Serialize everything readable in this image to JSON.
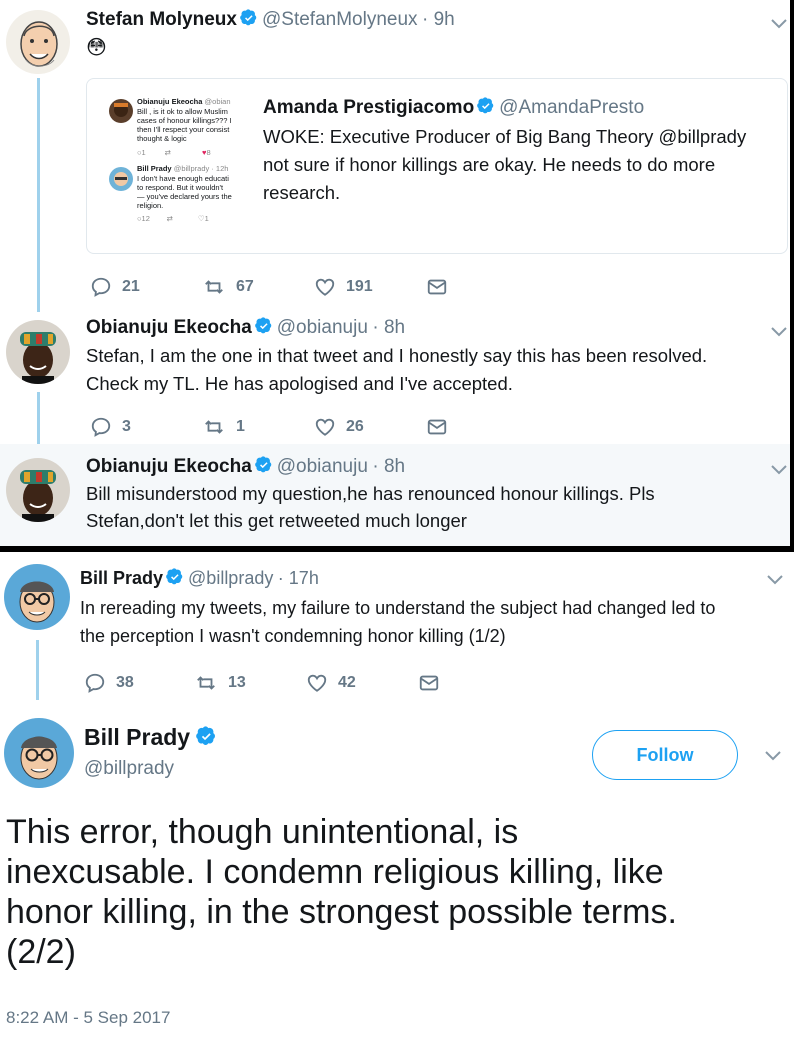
{
  "thread1": {
    "name": "Stefan Molyneux",
    "handle": "@StefanMolyneux",
    "time": "· 9h",
    "body": "😳",
    "quote": {
      "name": "Amanda Prestigiacomo",
      "handle": "@AmandaPresto",
      "text": "WOKE: Executive Producer of Big Bang Theory @billprady not sure if honor killings are okay. He needs to do more research.",
      "mini": {
        "t1_name": "Obianuju Ekeocha",
        "t1_handle": "@obian",
        "t1_line1": "Bill , is it ok to allow Muslim",
        "t1_line2": "cases of honour killings??? I",
        "t1_line3": "then I'll respect your consist",
        "t1_line4": "thought & logic",
        "t1_reply": "1",
        "t1_like": "8",
        "t2_name": "Bill Prady",
        "t2_handle": "@billprady · 12h",
        "t2_line1": "I don't have enough educati",
        "t2_line2": "to respond.  But it wouldn't",
        "t2_line3": "— you've declared yours the",
        "t2_line4": "religion.",
        "t2_reply": "12",
        "t2_like": "1"
      }
    },
    "replies": "21",
    "retweets": "67",
    "likes": "191"
  },
  "thread2": {
    "name": "Obianuju Ekeocha",
    "handle": "@obianuju",
    "time": "· 8h",
    "line1": "Stefan, I am the one in that tweet and I honestly say this has been resolved.",
    "line2": "Check my TL. He has apologised and I've accepted.",
    "replies": "3",
    "retweets": "1",
    "likes": "26"
  },
  "thread3": {
    "name": "Obianuju Ekeocha",
    "handle": "@obianuju",
    "time": "· 8h",
    "line1": "Bill misunderstood my question,he has renounced honour killings. Pls",
    "line2": "Stefan,don't let this get retweeted much longer"
  },
  "thread4": {
    "name": "Bill Prady",
    "handle": "@billprady",
    "time": "· 17h",
    "line1": "In rereading my tweets, my failure to understand the subject had changed led to",
    "line2": "the perception I wasn't condemning honor killing (1/2)",
    "replies": "38",
    "retweets": "13",
    "likes": "42"
  },
  "main": {
    "name": "Bill Prady",
    "handle": "@billprady",
    "follow": "Follow",
    "line1": "This error, though unintentional, is",
    "line2": "inexcusable. I condemn religious killing, like",
    "line3": "honor killing, in the strongest possible terms.",
    "line4": "(2/2)",
    "timestamp": "8:22 AM - 5 Sep 2017"
  },
  "colors": {
    "accent": "#1da1f2",
    "muted": "#657786",
    "thread_line": "#9fd1ec",
    "like_red": "#e0245e"
  }
}
